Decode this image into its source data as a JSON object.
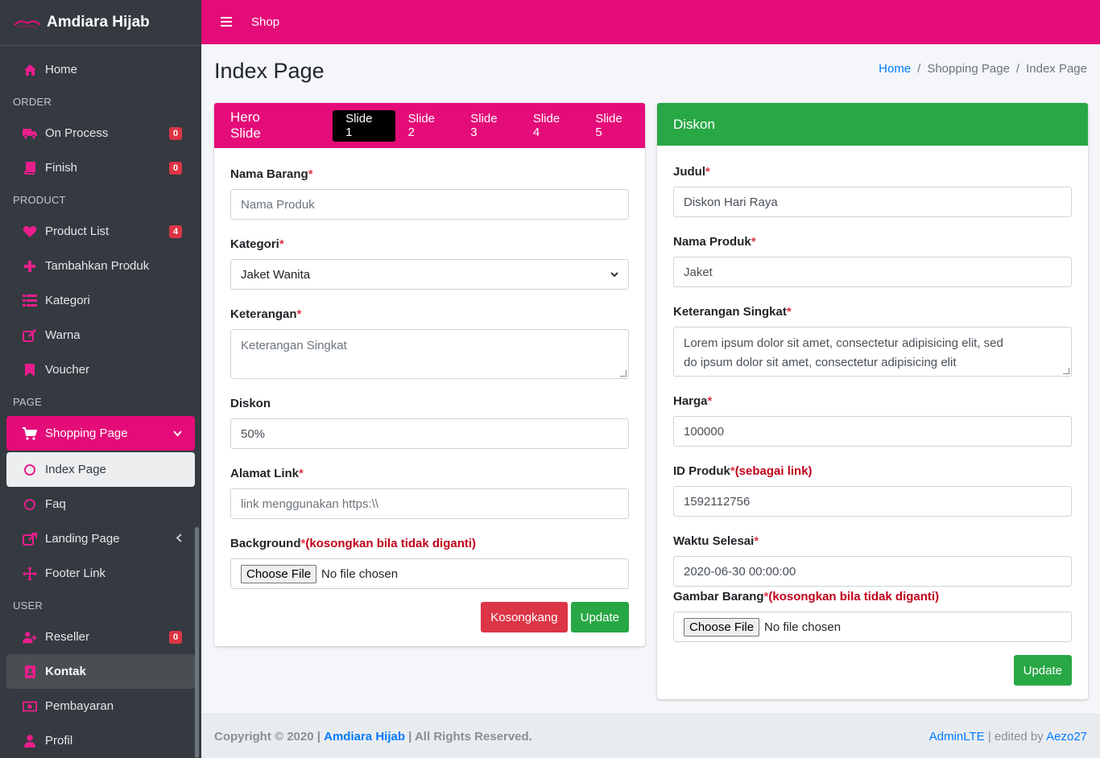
{
  "brand": {
    "name": "Amdiara Hijab"
  },
  "sidebar": {
    "home": "Home",
    "h_order": "ORDER",
    "on_process": {
      "label": "On Process",
      "badge": "0"
    },
    "finish": {
      "label": "Finish",
      "badge": "0"
    },
    "h_product": "PRODUCT",
    "product_list": {
      "label": "Product List",
      "badge": "4"
    },
    "tambahkan_produk": "Tambahkan Produk",
    "kategori": "Kategori",
    "warna": "Warna",
    "voucher": "Voucher",
    "h_page": "PAGE",
    "shopping_page": "Shopping Page",
    "index_page": "Index Page",
    "faq": "Faq",
    "landing_page": "Landing Page",
    "footer_link": "Footer Link",
    "h_user": "USER",
    "reseller": {
      "label": "Reseller",
      "badge": "0"
    },
    "kontak": "Kontak",
    "pembayaran": "Pembayaran",
    "profil": "Profil"
  },
  "topbar": {
    "shop": "Shop"
  },
  "page": {
    "title": "Index Page"
  },
  "breadcrumb": {
    "home": "Home",
    "sep": "/",
    "shopping": "Shopping Page",
    "current": "Index Page"
  },
  "hero": {
    "title": "Hero Slide",
    "tabs": [
      "Slide 1",
      "Slide 2",
      "Slide 3",
      "Slide 4",
      "Slide 5"
    ],
    "nama_barang_label": "Nama Barang",
    "nama_barang_placeholder": "Nama Produk",
    "kategori_label": "Kategori",
    "kategori_value": "Jaket Wanita",
    "keterangan_label": "Keterangan",
    "keterangan_placeholder": "Keterangan Singkat",
    "diskon_label": "Diskon",
    "diskon_value": "50%",
    "alamat_label": "Alamat Link",
    "alamat_placeholder": "link menggunakan https:\\\\",
    "background_label": "Background",
    "background_note": "(kosongkan bila tidak diganti)",
    "choose_file": "Choose File",
    "no_file": "No file chosen",
    "btn_kosong": "Kosongkang",
    "btn_update": "Update",
    "required": "*"
  },
  "diskon": {
    "title": "Diskon",
    "judul_label": "Judul",
    "judul_value": "Diskon Hari Raya",
    "nama_produk_label": "Nama Produk",
    "nama_produk_value": "Jaket",
    "keterangan_label": "Keterangan Singkat",
    "keterangan_line1": "Lorem ipsum dolor sit amet, consectetur adipisicing elit, sed",
    "keterangan_line2": "do ipsum dolor sit amet, consectetur adipisicing elit",
    "harga_label": "Harga",
    "harga_value": "100000",
    "id_label": "ID Produk",
    "id_note": "(sebagai link)",
    "id_value": "1592112756",
    "waktu_label": "Waktu Selesai",
    "waktu_value": "2020-06-30 00:00:00",
    "gambar_label": "Gambar Barang",
    "gambar_note": "(kosongkan bila tidak diganti)",
    "choose_file": "Choose File",
    "no_file": "No file chosen",
    "btn_update": "Update"
  },
  "footer": {
    "copyright": "Copyright © 2020 |",
    "brand": "Amdiara Hijab",
    "rights": "| All Rights Reserved.",
    "adminlte": "AdminLTE",
    "edited": "| edited by",
    "author": "Aezo27"
  },
  "colors": {
    "accent": "#e40c78",
    "sidebar": "#343a40",
    "green": "#28a745",
    "red": "#dc3545"
  }
}
